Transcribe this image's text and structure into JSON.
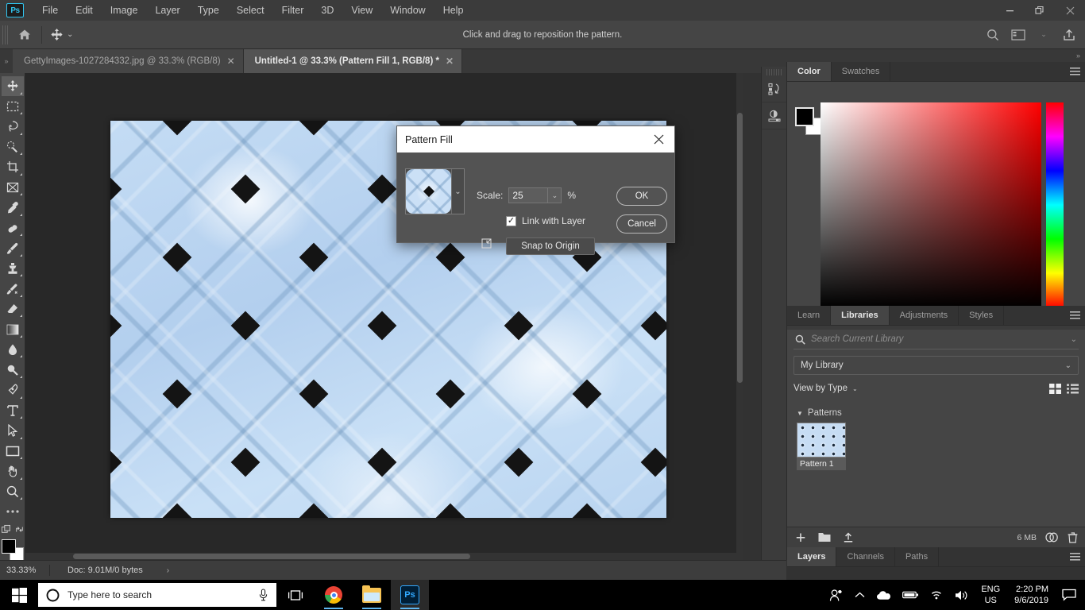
{
  "app": {
    "name": "Adobe Photoshop",
    "logo_text": "Ps"
  },
  "menubar": {
    "items": [
      "File",
      "Edit",
      "Image",
      "Layer",
      "Type",
      "Select",
      "Filter",
      "3D",
      "View",
      "Window",
      "Help"
    ]
  },
  "window_controls": {
    "minimize": "—",
    "restore": "❐",
    "close": "✕"
  },
  "options_bar": {
    "hint": "Click and drag to reposition the pattern.",
    "home_icon": "home-icon",
    "tool_icon": "move-tool-icon",
    "chevron": "⌄",
    "right_icons": [
      "search-icon",
      "workspace-icon",
      "chevron-down-icon",
      "share-icon"
    ]
  },
  "tabs": [
    {
      "label": "GettyImages-1027284332.jpg @ 33.3% (RGB/8)",
      "close": "✕",
      "active": false
    },
    {
      "label": "Untitled-1 @ 33.3% (Pattern Fill 1, RGB/8) *",
      "close": "✕",
      "active": true
    }
  ],
  "toolbar": {
    "tools": [
      {
        "name": "move-tool",
        "selected": true
      },
      {
        "name": "rectangular-marquee-tool",
        "selected": false
      },
      {
        "name": "lasso-tool",
        "selected": false
      },
      {
        "name": "quick-selection-tool",
        "selected": false
      },
      {
        "name": "crop-tool",
        "selected": false
      },
      {
        "name": "frame-tool",
        "selected": false
      },
      {
        "name": "eyedropper-tool",
        "selected": false
      },
      {
        "name": "healing-brush-tool",
        "selected": false
      },
      {
        "name": "brush-tool",
        "selected": false
      },
      {
        "name": "clone-stamp-tool",
        "selected": false
      },
      {
        "name": "history-brush-tool",
        "selected": false
      },
      {
        "name": "eraser-tool",
        "selected": false
      },
      {
        "name": "gradient-tool",
        "selected": false
      },
      {
        "name": "blur-tool",
        "selected": false
      },
      {
        "name": "dodge-tool",
        "selected": false
      },
      {
        "name": "pen-tool",
        "selected": false
      },
      {
        "name": "type-tool",
        "selected": false
      },
      {
        "name": "path-selection-tool",
        "selected": false
      },
      {
        "name": "rectangle-tool",
        "selected": false
      },
      {
        "name": "hand-tool",
        "selected": false
      },
      {
        "name": "zoom-tool",
        "selected": false
      },
      {
        "name": "edit-toolbar-tool",
        "selected": false
      }
    ],
    "foreground_color": "#000000",
    "background_color": "#ffffff"
  },
  "dialog": {
    "title": "Pattern Fill",
    "close_label": "✕",
    "scale_label": "Scale:",
    "scale_value": "25",
    "scale_unit": "%",
    "link_with_layer_label": "Link with Layer",
    "link_with_layer_checked": true,
    "checkmark": "✓",
    "snap_to_origin_label": "Snap to Origin",
    "ok_label": "OK",
    "cancel_label": "Cancel",
    "pattern_dropdown_chevron": "⌄",
    "scale_dropdown_chevron": "⌄"
  },
  "status_bar": {
    "zoom": "33.33%",
    "doc": "Doc: 9.01M/0 bytes",
    "arrow": "›"
  },
  "panels": {
    "dock_mini": [
      {
        "name": "history-panel-icon"
      },
      {
        "name": "adjustments-panel-icon"
      }
    ],
    "color_group": {
      "tabs": [
        {
          "label": "Color",
          "active": true
        },
        {
          "label": "Swatches",
          "active": false
        }
      ],
      "menu_icon": "panel-menu-icon",
      "foreground_color": "#000000",
      "background_color": "#ffffff"
    },
    "libraries_group": {
      "tabs": [
        {
          "label": "Learn",
          "active": false
        },
        {
          "label": "Libraries",
          "active": true
        },
        {
          "label": "Adjustments",
          "active": false
        },
        {
          "label": "Styles",
          "active": false
        }
      ],
      "menu_icon": "panel-menu-icon",
      "search_placeholder": "Search Current Library",
      "search_icon": "search-icon",
      "search_chevron": "⌄",
      "library_select": "My Library",
      "library_chevron": "⌄",
      "view_by": "View by Type",
      "view_by_chevron": "⌄",
      "view_icons": [
        "grid-view-icon",
        "list-view-icon"
      ],
      "group_title": "Patterns",
      "group_triangle": "▼",
      "assets": [
        {
          "label": "Pattern 1"
        }
      ],
      "footer": {
        "add_icon": "add-icon",
        "folder_icon": "folder-icon",
        "upload_icon": "upload-icon",
        "size": "6 MB",
        "cloud_icon": "creative-cloud-icon",
        "delete_icon": "trash-icon"
      }
    },
    "layers_group": {
      "tabs": [
        {
          "label": "Layers",
          "active": true
        },
        {
          "label": "Channels",
          "active": false
        },
        {
          "label": "Paths",
          "active": false
        }
      ],
      "menu_icon": "panel-menu-icon"
    }
  },
  "canvas": {
    "zoom_label": "33.33%",
    "pattern_name": "blue diamond lattice pattern",
    "background_color": "#282828"
  },
  "taskbar": {
    "start_icon": "windows-start-icon",
    "search_placeholder": "Type here to search",
    "cortana_icon": "cortana-icon",
    "mic_icon": "microphone-icon",
    "task_view_icon": "task-view-icon",
    "apps": [
      {
        "name": "chrome-taskbar-icon",
        "running": true,
        "active": false
      },
      {
        "name": "file-explorer-taskbar-icon",
        "running": true,
        "active": false
      },
      {
        "name": "photoshop-taskbar-icon",
        "running": true,
        "active": true,
        "label": "Ps"
      }
    ],
    "tray": {
      "people_icon": "people-icon",
      "expand_icon": "show-hidden-icons-icon",
      "onedrive_icon": "onedrive-icon",
      "battery_icon": "battery-icon",
      "network_icon": "wifi-icon",
      "volume_icon": "volume-icon",
      "language_line1": "ENG",
      "language_line2": "US",
      "time": "2:20 PM",
      "date": "9/6/2019",
      "notifications_icon": "notifications-icon"
    }
  }
}
